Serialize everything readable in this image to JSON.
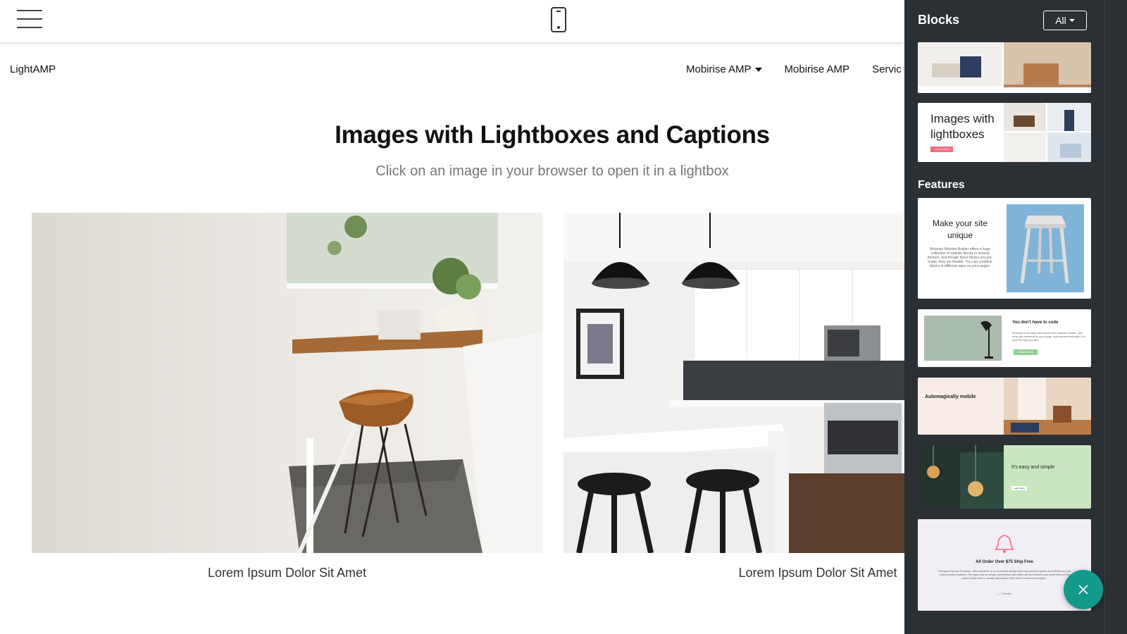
{
  "site": {
    "brand": "LightAMP",
    "nav": [
      {
        "label": "Mobirise AMP",
        "dropdown": true
      },
      {
        "label": "Mobirise AMP",
        "dropdown": false
      },
      {
        "label": "Servic",
        "dropdown": false
      }
    ]
  },
  "section": {
    "title": "Images with Lightboxes and Captions",
    "subtitle": "Click on an image in your browser to open it in a lightbox",
    "captions": [
      "Lorem Ipsum Dolor Sit Amet",
      "Lorem Ipsum Dolor Sit Amet"
    ]
  },
  "sidebar": {
    "title": "Blocks",
    "filter": "All",
    "section_label": "Features",
    "thumbs": {
      "lightbox_title": "Images with lightboxes",
      "lightbox_btn": "Learn More",
      "f1_title": "Make your site unique",
      "f1_body": "Mobirise Website Builder offers a huge collection of website blocks in several themes, and though these blocks are pre-made, they are flexible. You can combine blocks in different ways on your pages.",
      "f2_title": "You don't have to code",
      "f2_body": "Mobirise is an easy and simple free website builder - just drop site elements to your page, add content and style it to look the way you like.",
      "f2_btn": "READ NOW",
      "f3_title": "Automagically mobile",
      "f4_title": "It's easy and simple",
      "f4_btn": "Learn More",
      "f5_title": "All Order Over $75 Ship Free",
      "f5_body": "\"Designed by Ian Rowland, Merchandiser is a minimalist design that emphasizes speed and efficiency over unnecessary features. The goal was to design something that offers all the features you need without the added bloat that is usually associated with WooCommerce designs.\"",
      "f5_author": "— Themes"
    }
  },
  "colors": {
    "sidebar_bg": "#2b3035",
    "fab": "#149a8a",
    "accent_pink": "#f46a7e"
  }
}
